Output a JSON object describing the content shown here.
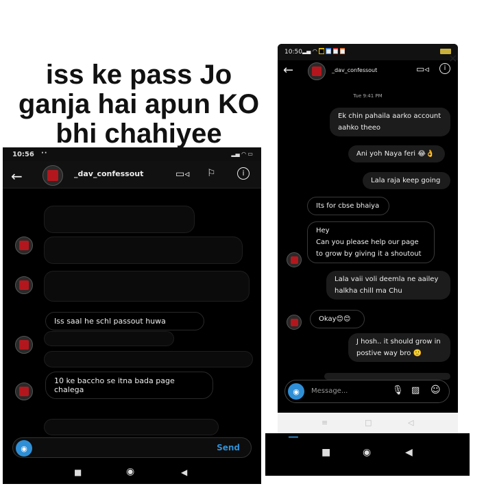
{
  "caption": {
    "line1": "iss ke pass Jo",
    "line2": "ganja hai apun KO",
    "line3": "bhi chahiyee"
  },
  "left_phone": {
    "status_time": "10:56",
    "status_dots": "··",
    "username": "_dav_confessout",
    "back_icon": "←",
    "icons": [
      "video-call-icon",
      "flag-icon",
      "info-icon"
    ],
    "messages": [
      {
        "text": "Iss saal he schl passout huwa"
      },
      {
        "text": "10 ke baccho se itna bada page chalega"
      }
    ],
    "composer": {
      "send_label": "Send"
    },
    "nav": [
      "■",
      "◉",
      "◀"
    ]
  },
  "right_phone": {
    "status_time": "10:50",
    "username": "_dav_confessout",
    "timestamp": "Tue 9:41 PM",
    "messages": [
      {
        "dir": "out",
        "text": "Ek chin pahaila aarko account aahko theeo"
      },
      {
        "dir": "out",
        "text": "Ani yoh Naya feri 😂👌"
      },
      {
        "dir": "out",
        "text": "Lala raja keep going"
      },
      {
        "dir": "in",
        "text": "Its for cbse bhaiya"
      },
      {
        "dir": "in",
        "text": "Hey\nCan you please help our page to grow by giving it a shoutout"
      },
      {
        "dir": "out",
        "text": "Lala vaii voli deemla ne aailey halkha chill ma Chu"
      },
      {
        "dir": "in",
        "text": "Okay😊😊"
      },
      {
        "dir": "out",
        "text": "J hosh.. it should grow in postive way bro 🙂"
      }
    ],
    "composer": {
      "placeholder": "Message..."
    },
    "nav": [
      "≡",
      "□",
      "◁"
    ]
  },
  "bottom_nav": [
    "■",
    "◉",
    "◀"
  ],
  "colors": {
    "accent": "#2f8fd6",
    "bubble": "#1c1c1c",
    "avatar": "#b3171d"
  }
}
